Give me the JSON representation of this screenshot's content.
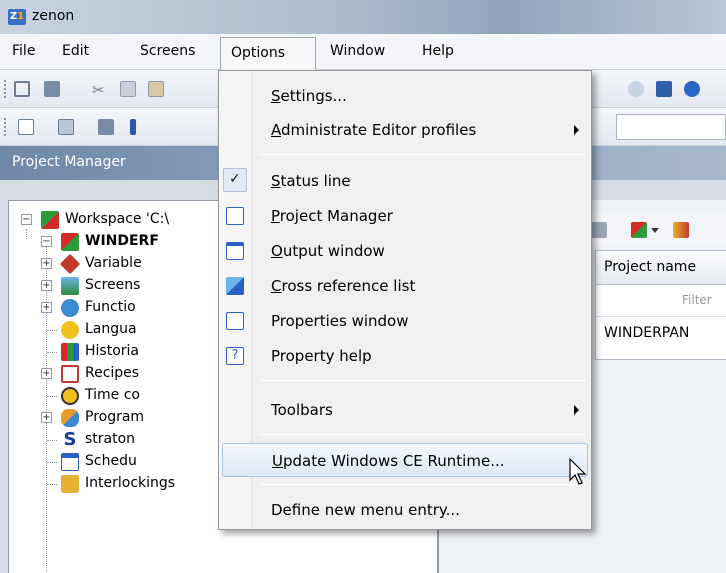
{
  "window": {
    "title": "zenon",
    "icon": "zenon-app-icon"
  },
  "menubar": {
    "items": [
      {
        "label": "File"
      },
      {
        "label": "Edit"
      },
      {
        "label": "Screens"
      },
      {
        "label": "Options"
      },
      {
        "label": "Window"
      },
      {
        "label": "Help"
      }
    ]
  },
  "project_manager": {
    "title": "Project Manager"
  },
  "tree": {
    "workspace": "Workspace 'C:\\",
    "project": "WINDERF",
    "items": [
      {
        "label": "Variable",
        "icon": "variables-icon"
      },
      {
        "label": "Screens",
        "icon": "screens-icon"
      },
      {
        "label": "Functio",
        "icon": "functions-icon"
      },
      {
        "label": "Langua",
        "icon": "language-icon"
      },
      {
        "label": "Historia",
        "icon": "historian-icon"
      },
      {
        "label": "Recipes",
        "icon": "recipes-icon"
      },
      {
        "label": "Time co",
        "icon": "clock-icon"
      },
      {
        "label": "Program",
        "icon": "programming-icon"
      },
      {
        "label": "straton",
        "icon": "straton-icon"
      },
      {
        "label": "Schedu",
        "icon": "scheduler-icon"
      },
      {
        "label": "Interlockings",
        "icon": "lock-icon"
      }
    ]
  },
  "right_pane": {
    "column_header": "Project name",
    "filter_placeholder": "Filter",
    "row_value": "WINDERPAN"
  },
  "options_menu": {
    "items": [
      {
        "label": "Settings...",
        "mnemonic": "S",
        "rest": "ettings..."
      },
      {
        "label": "Administrate Editor profiles",
        "mnemonic": "A",
        "rest": "dministrate Editor profiles",
        "submenu": true
      },
      {
        "label": "Status line",
        "mnemonic": "S",
        "rest": "tatus line",
        "checked": true
      },
      {
        "label": "Project Manager",
        "mnemonic": "P",
        "rest": "roject Manager",
        "icon": "project-manager-icon"
      },
      {
        "label": "Output window",
        "mnemonic": "O",
        "rest": "utput window",
        "icon": "output-window-icon"
      },
      {
        "label": "Cross reference list",
        "mnemonic": "C",
        "rest": "ross reference list",
        "icon": "cross-reference-icon"
      },
      {
        "label": "Properties window",
        "icon": "properties-icon"
      },
      {
        "label": "Property help",
        "icon": "help-icon"
      },
      {
        "label": "Toolbars",
        "submenu": true
      },
      {
        "label": "Update Windows CE Runtime...",
        "mnemonic": "U",
        "rest": "pdate Windows CE Runtime...",
        "highlighted": true
      },
      {
        "label": "Define new menu entry..."
      }
    ]
  },
  "colors": {
    "menu_bg": "#f0f0f0",
    "highlight_border": "#a9c2df",
    "header_gradient": "#6e87a8"
  }
}
